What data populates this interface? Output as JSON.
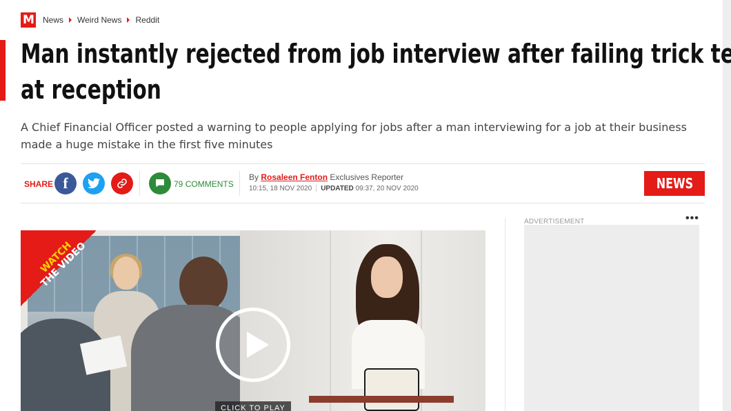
{
  "logo": {
    "letter": "M"
  },
  "breadcrumb": [
    "News",
    "Weird News",
    "Reddit"
  ],
  "article": {
    "headline_line1": "Man instantly rejected from job interview after failing trick test",
    "headline_line2": "at reception",
    "standfirst": "A Chief Financial Officer posted a warning to people applying for jobs after a man interviewing for a job at their business made a huge mistake in the first five minutes"
  },
  "share": {
    "label": "SHARE",
    "facebook_glyph": "f",
    "comments_count": "79",
    "comments_label": "COMMENTS"
  },
  "byline": {
    "prefix": "By",
    "author": "Rosaleen Fenton",
    "role": "Exclusives Reporter",
    "published": "10:15, 18 NOV 2020",
    "updated_label": "UPDATED",
    "updated": "09:37, 20 NOV 2020"
  },
  "section_badge": "NEWS",
  "video": {
    "corner_line1": "WATCH",
    "corner_line2": "THE VIDEO",
    "cta": "CLICK TO PLAY"
  },
  "sidebar": {
    "ad_label": "ADVERTISEMENT",
    "menu_dots": "•••"
  },
  "colors": {
    "brand_red": "#e41b17",
    "facebook": "#3b5998",
    "twitter": "#1da1f2",
    "comments_green": "#2e8b3a"
  },
  "icons": [
    "mirror-logo-icon",
    "chevron-right-icon",
    "facebook-icon",
    "twitter-icon",
    "link-icon",
    "comment-bubble-icon",
    "play-icon",
    "more-dots-icon"
  ]
}
